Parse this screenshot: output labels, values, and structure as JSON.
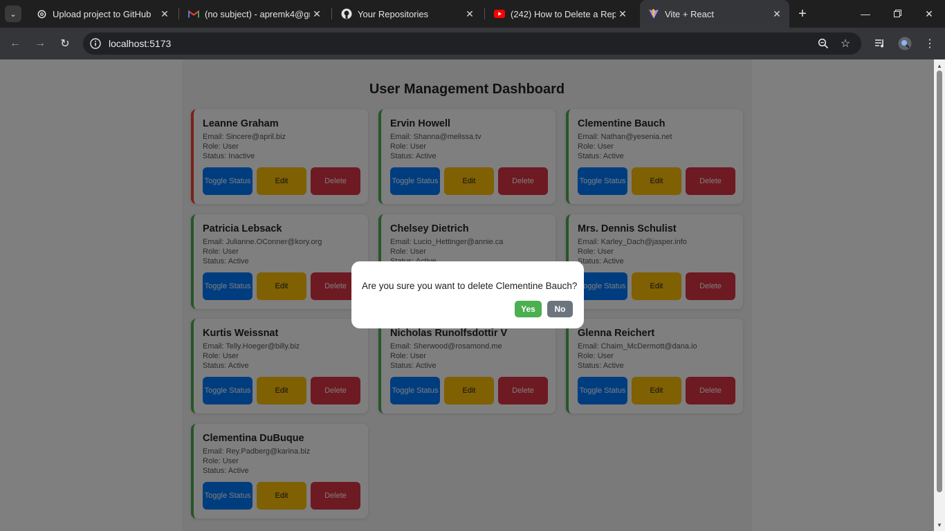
{
  "browser": {
    "tabs": [
      {
        "title": "Upload project to GitHub",
        "icon": "openai-icon"
      },
      {
        "title": "(no subject) - apremk4@gmail.com",
        "icon": "gmail-icon"
      },
      {
        "title": "Your Repositories",
        "icon": "github-icon"
      },
      {
        "title": "(242) How to Delete a Repository",
        "icon": "youtube-icon"
      },
      {
        "title": "Vite + React",
        "icon": "vite-icon",
        "active": true
      }
    ],
    "url": "localhost:5173"
  },
  "page": {
    "title": "User Management Dashboard",
    "users": [
      {
        "name": "Leanne Graham",
        "email": "Email: Sincere@april.biz",
        "role": "Role: User",
        "status": "Status: Inactive",
        "active": false
      },
      {
        "name": "Ervin Howell",
        "email": "Email: Shanna@melissa.tv",
        "role": "Role: User",
        "status": "Status: Active",
        "active": true
      },
      {
        "name": "Clementine Bauch",
        "email": "Email: Nathan@yesenia.net",
        "role": "Role: User",
        "status": "Status: Active",
        "active": true
      },
      {
        "name": "Patricia Lebsack",
        "email": "Email: Julianne.OConner@kory.org",
        "role": "Role: User",
        "status": "Status: Active",
        "active": true
      },
      {
        "name": "Chelsey Dietrich",
        "email": "Email: Lucio_Hettinger@annie.ca",
        "role": "Role: User",
        "status": "Status: Active",
        "active": true
      },
      {
        "name": "Mrs. Dennis Schulist",
        "email": "Email: Karley_Dach@jasper.info",
        "role": "Role: User",
        "status": "Status: Active",
        "active": true
      },
      {
        "name": "Kurtis Weissnat",
        "email": "Email: Telly.Hoeger@billy.biz",
        "role": "Role: User",
        "status": "Status: Active",
        "active": true
      },
      {
        "name": "Nicholas Runolfsdottir V",
        "email": "Email: Sherwood@rosamond.me",
        "role": "Role: User",
        "status": "Status: Active",
        "active": true
      },
      {
        "name": "Glenna Reichert",
        "email": "Email: Chaim_McDermott@dana.io",
        "role": "Role: User",
        "status": "Status: Active",
        "active": true
      },
      {
        "name": "Clementina DuBuque",
        "email": "Email: Rey.Padberg@karina.biz",
        "role": "Role: User",
        "status": "Status: Active",
        "active": true
      }
    ],
    "buttons": {
      "toggle": "Toggle Status",
      "edit": "Edit",
      "delete": "Delete"
    }
  },
  "modal": {
    "message": "Are you sure you want to delete Clementine Bauch?",
    "yes": "Yes",
    "no": "No"
  },
  "colors": {
    "active_border": "#4caf50",
    "inactive_border": "#f44336",
    "toggle": "#007bff",
    "edit": "#ffc107",
    "delete": "#dc3545"
  }
}
